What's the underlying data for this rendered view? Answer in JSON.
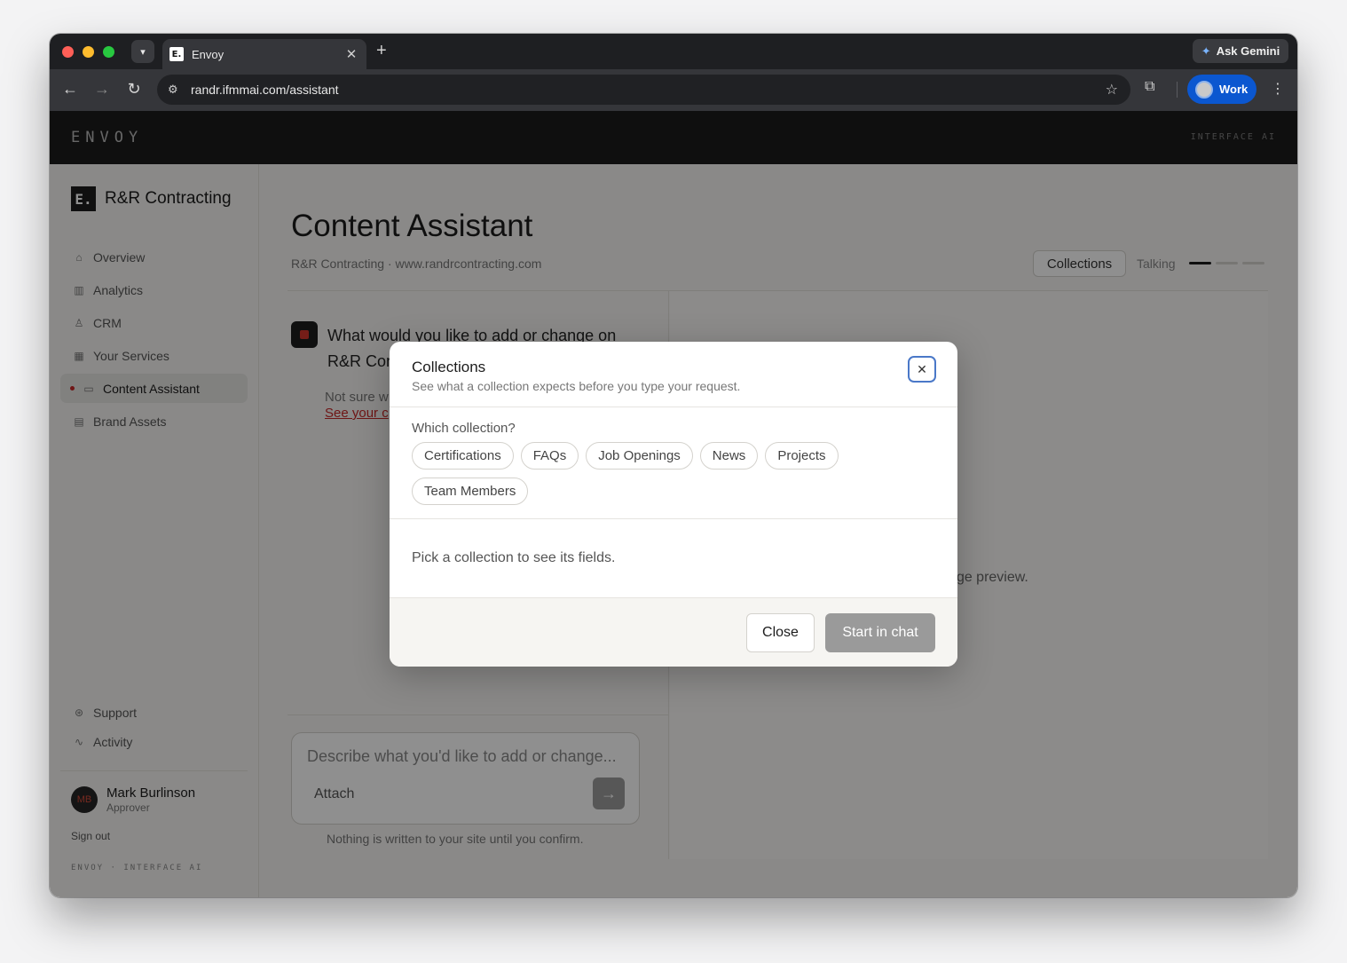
{
  "browser": {
    "tab_title": "Envoy",
    "favicon_text": "E.",
    "url": "randr.ifmmai.com/assistant",
    "ask_gemini": "Ask Gemini",
    "profile": "Work"
  },
  "app": {
    "brand": "ENVOY",
    "tagline": "INTERFACE AI"
  },
  "sidebar": {
    "org_logo": "E.",
    "org_name": "R&R Contracting",
    "items": [
      {
        "label": "Overview",
        "icon": "home-icon"
      },
      {
        "label": "Analytics",
        "icon": "bar-chart-icon"
      },
      {
        "label": "CRM",
        "icon": "person-icon"
      },
      {
        "label": "Your Services",
        "icon": "grid-icon"
      },
      {
        "label": "Content Assistant",
        "icon": "chat-icon",
        "active": true
      },
      {
        "label": "Brand Assets",
        "icon": "images-icon"
      }
    ],
    "bottom_items": [
      {
        "label": "Support",
        "icon": "lifebuoy-icon"
      },
      {
        "label": "Activity",
        "icon": "activity-icon"
      }
    ],
    "user": {
      "initials": "MB",
      "name": "Mark Burlinson",
      "role": "Approver"
    },
    "sign_out": "Sign out",
    "footer": "ENVOY · INTERFACE AI"
  },
  "main": {
    "title": "Content Assistant",
    "subtitle": "R&R Contracting  ·  www.randrcontracting.com",
    "collections_button": "Collections",
    "status": "Talking",
    "bot_question": "What would you like to add or change on R&R Con",
    "hint": "Not sure w",
    "hint_link": "See your c",
    "preview_text": "e a live page preview.",
    "composer_placeholder": "Describe what you'd like to add or change...",
    "attach": "Attach",
    "note": "Nothing is written to your site until you confirm."
  },
  "modal": {
    "title": "Collections",
    "subtitle": "See what a collection expects before you type your request.",
    "question": "Which collection?",
    "collections": [
      "Certifications",
      "FAQs",
      "Job Openings",
      "News",
      "Projects",
      "Team Members"
    ],
    "empty_state": "Pick a collection to see its fields.",
    "close_button": "Close",
    "start_button": "Start in chat"
  }
}
